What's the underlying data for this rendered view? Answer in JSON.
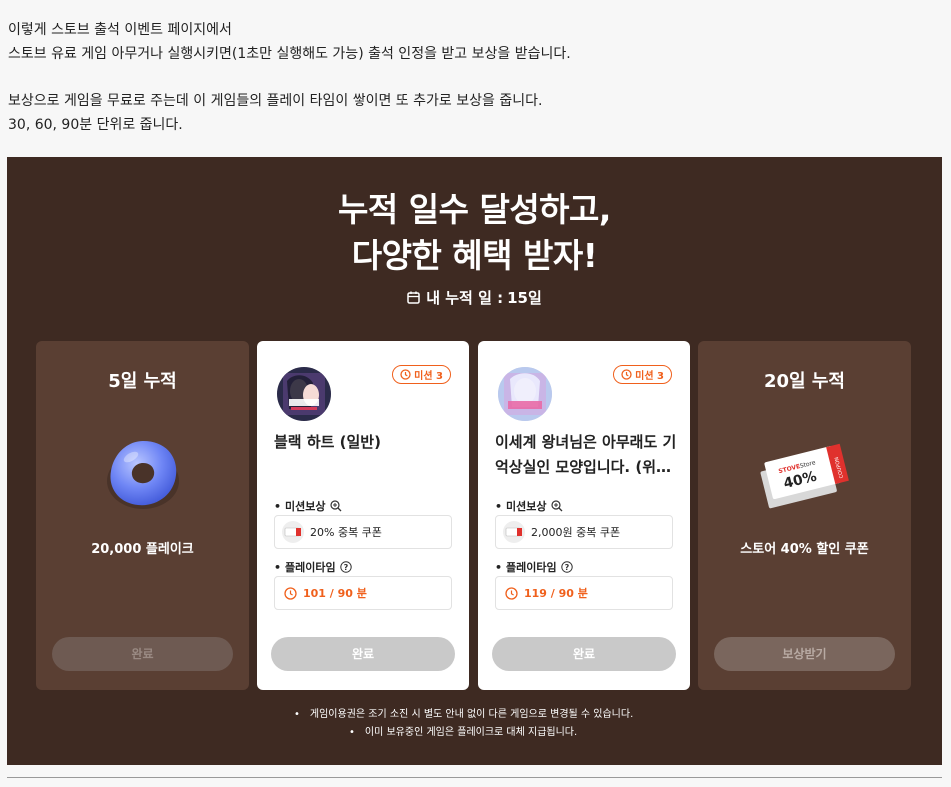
{
  "intro": {
    "lines": [
      "이렇게 스토브 출석 이벤트 페이지에서",
      "스토브 유료 게임 아무거나 실행시키면(1초만 실행해도 가능) 출석 인정을 받고 보상을 받습니다.",
      "보상으로 게임을 무료로 주는데 이 게임들의 플레이 타임이 쌓이면 또 추가로 보상을 줍니다.",
      "30, 60, 90분 단위로 줍니다."
    ]
  },
  "banner": {
    "headline_line1": "누적 일수 달성하고,",
    "headline_line2": "다양한 혜택 받자!",
    "my_days_label": "내 누적 일 :",
    "my_days_value": "15일",
    "background_color": "#3e2a22",
    "accent_color": "#f0601c"
  },
  "cards": {
    "c1": {
      "title": "5일 누적",
      "reward": "20,000 플레이크",
      "button": "완료",
      "icon": "donut-icon"
    },
    "c2": {
      "mission_badge": "미션 3",
      "game_title": "블랙 하트 (일반)",
      "reward_label": "미션보상",
      "reward_value": "20% 중복 쿠폰",
      "playtime_label": "플레이타임",
      "playtime_value": "101 / 90 분",
      "button": "완료"
    },
    "c3": {
      "mission_badge": "미션 3",
      "game_title": "이세계 왕녀님은 아무래도 기억상실인 모양입니다. (위…",
      "reward_label": "미션보상",
      "reward_value": "2,000원 중복 쿠폰",
      "playtime_label": "플레이타임",
      "playtime_value": "119 / 90 분",
      "button": "완료"
    },
    "c4": {
      "title": "20일 누적",
      "reward": "스토어 40% 할인 쿠폰",
      "button": "보상받기",
      "icon": "coupon-icon",
      "coupon_brand": "STOVE Store",
      "coupon_percent": "40%",
      "coupon_side": "COUPON"
    }
  },
  "notes": [
    "게임이용권은 조기 소진 시 별도 안내 없이 다른 게임으로 변경될 수 있습니다.",
    "이미 보유중인 게임은 플레이크로 대체 지급됩니다."
  ]
}
